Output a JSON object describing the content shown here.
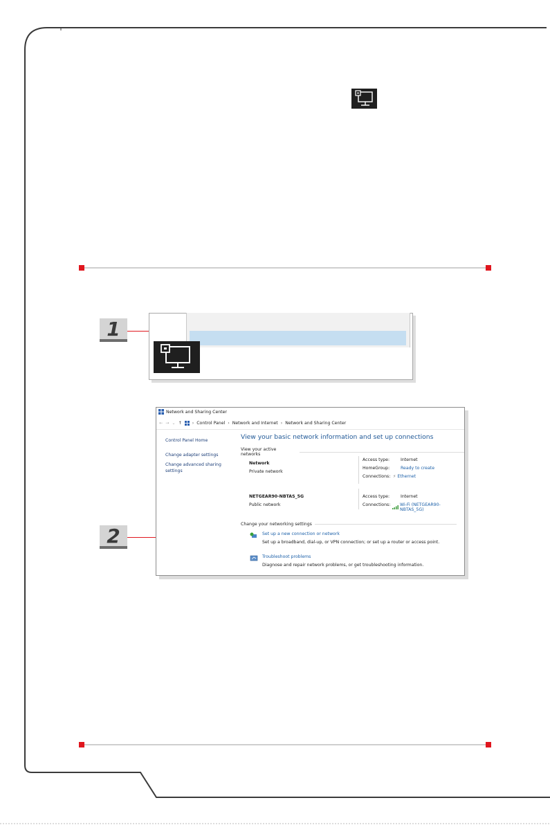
{
  "taskbar_icon": "network-monitor-icon",
  "badges": {
    "step1": "1",
    "step2": "2"
  },
  "colors": {
    "accent": "#e0161e",
    "badge_bg": "#d4d4d4",
    "window_heading": "#1e5796",
    "link": "#1a5fa8"
  },
  "window": {
    "title": "Network and Sharing Center",
    "breadcrumb": [
      "Control Panel",
      "Network and Internet",
      "Network and Sharing Center"
    ],
    "sidebar": [
      "Control Panel Home",
      "Change adapter settings",
      "Change advanced sharing",
      "settings"
    ],
    "heading": "View your basic network information and set up connections",
    "active_networks_label": "View your active networks",
    "networks": [
      {
        "name": "Network",
        "type": "Private network",
        "access_type_label": "Access type:",
        "access_type": "Internet",
        "homegroup_label": "HomeGroup:",
        "homegroup": "Ready to create",
        "connections_label": "Connections:",
        "connection": "Ethernet"
      },
      {
        "name": "NETGEAR90-NBTAS_5G",
        "type": "Public network",
        "access_type_label": "Access type:",
        "access_type": "Internet",
        "connections_label": "Connections:",
        "connection": "Wi-Fi (NETGEAR90-NBTAS_5G)"
      }
    ],
    "change_settings_label": "Change your networking settings",
    "actions": [
      {
        "title": "Set up a new connection or network",
        "desc": "Set up a broadband, dial-up, or VPN connection; or set up a router or access point.",
        "icon": "new-connection-icon"
      },
      {
        "title": "Troubleshoot problems",
        "desc": "Diagnose and repair network problems, or get troubleshooting information.",
        "icon": "troubleshoot-icon"
      }
    ]
  }
}
